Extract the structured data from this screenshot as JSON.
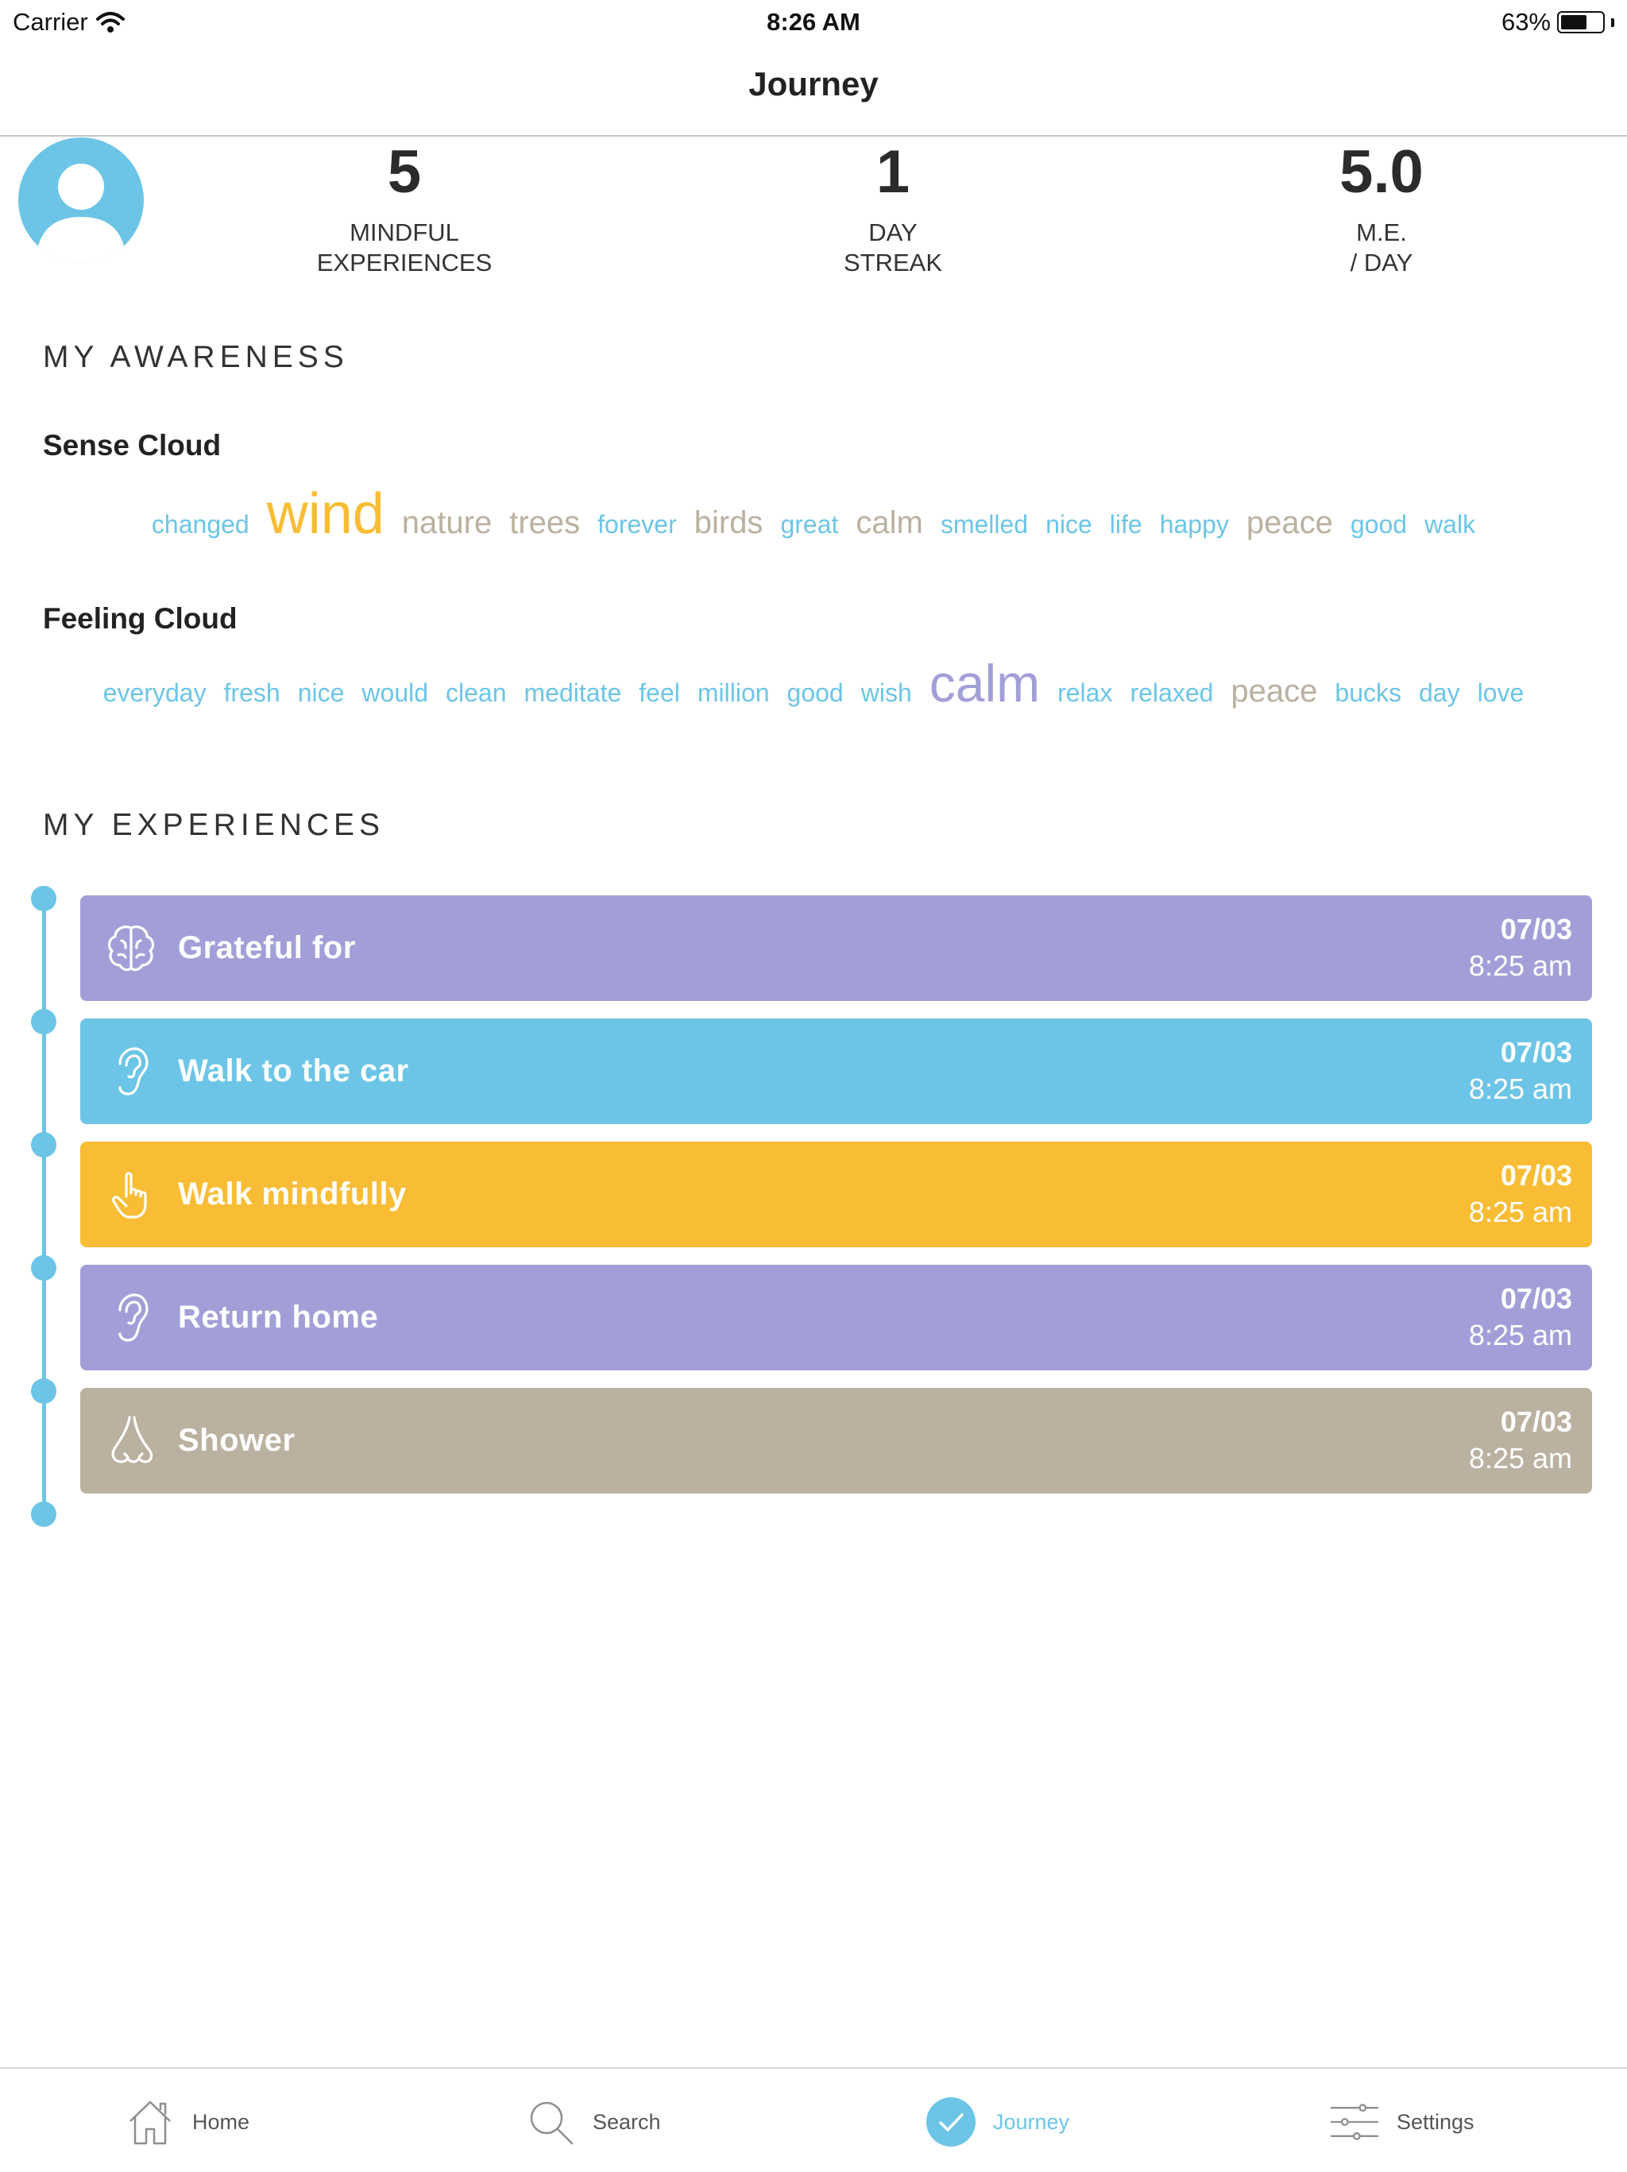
{
  "status": {
    "carrier": "Carrier",
    "time": "8:26 AM",
    "battery": "63%",
    "battery_level": 0.63
  },
  "nav": {
    "title": "Journey"
  },
  "stats": [
    {
      "value": "5",
      "line1": "MINDFUL",
      "line2": "EXPERIENCES"
    },
    {
      "value": "1",
      "line1": "DAY",
      "line2": "STREAK"
    },
    {
      "value": "5.0",
      "line1": "M.E.",
      "line2": "/ DAY"
    }
  ],
  "awareness": {
    "heading": "MY AWARENESS",
    "sense_title": "Sense Cloud",
    "sense_words": [
      "changed",
      "wind",
      "nature",
      "trees",
      "forever",
      "birds",
      "great",
      "calm",
      "smelled",
      "nice",
      "life",
      "happy",
      "peace",
      "good",
      "walk"
    ],
    "feeling_title": "Feeling Cloud",
    "feeling_words": [
      "everyday",
      "fresh",
      "nice",
      "would",
      "clean",
      "meditate",
      "feel",
      "million",
      "good",
      "wish",
      "calm",
      "relax",
      "relaxed",
      "peace",
      "bucks",
      "day",
      "love"
    ]
  },
  "experiences": {
    "heading": "MY EXPERIENCES",
    "items": [
      {
        "title": "Grateful for",
        "date": "07/03",
        "time": "8:25 am",
        "color": "#a29fd8",
        "icon": "brain-icon"
      },
      {
        "title": "Walk to the car",
        "date": "07/03",
        "time": "8:25 am",
        "color": "#6cc5e6",
        "icon": "ear-icon"
      },
      {
        "title": "Walk mindfully",
        "date": "07/03",
        "time": "8:25 am",
        "color": "#f8bd35",
        "icon": "hand-pointer-icon"
      },
      {
        "title": "Return home",
        "date": "07/03",
        "time": "8:25 am",
        "color": "#a29fd8",
        "icon": "ear-icon"
      },
      {
        "title": "Shower",
        "date": "07/03",
        "time": "8:25 am",
        "color": "#bab1a0",
        "icon": "nose-icon"
      }
    ]
  },
  "colors": {
    "blue": "#6cc5e6",
    "purple": "#a29fd8",
    "yellow": "#f8bd35",
    "tan": "#bab1a0"
  },
  "tabs": [
    {
      "label": "Home",
      "icon": "home-icon",
      "active": false
    },
    {
      "label": "Search",
      "icon": "search-icon",
      "active": false
    },
    {
      "label": "Journey",
      "icon": "check-circle-icon",
      "active": true
    },
    {
      "label": "Settings",
      "icon": "sliders-icon",
      "active": false
    }
  ]
}
